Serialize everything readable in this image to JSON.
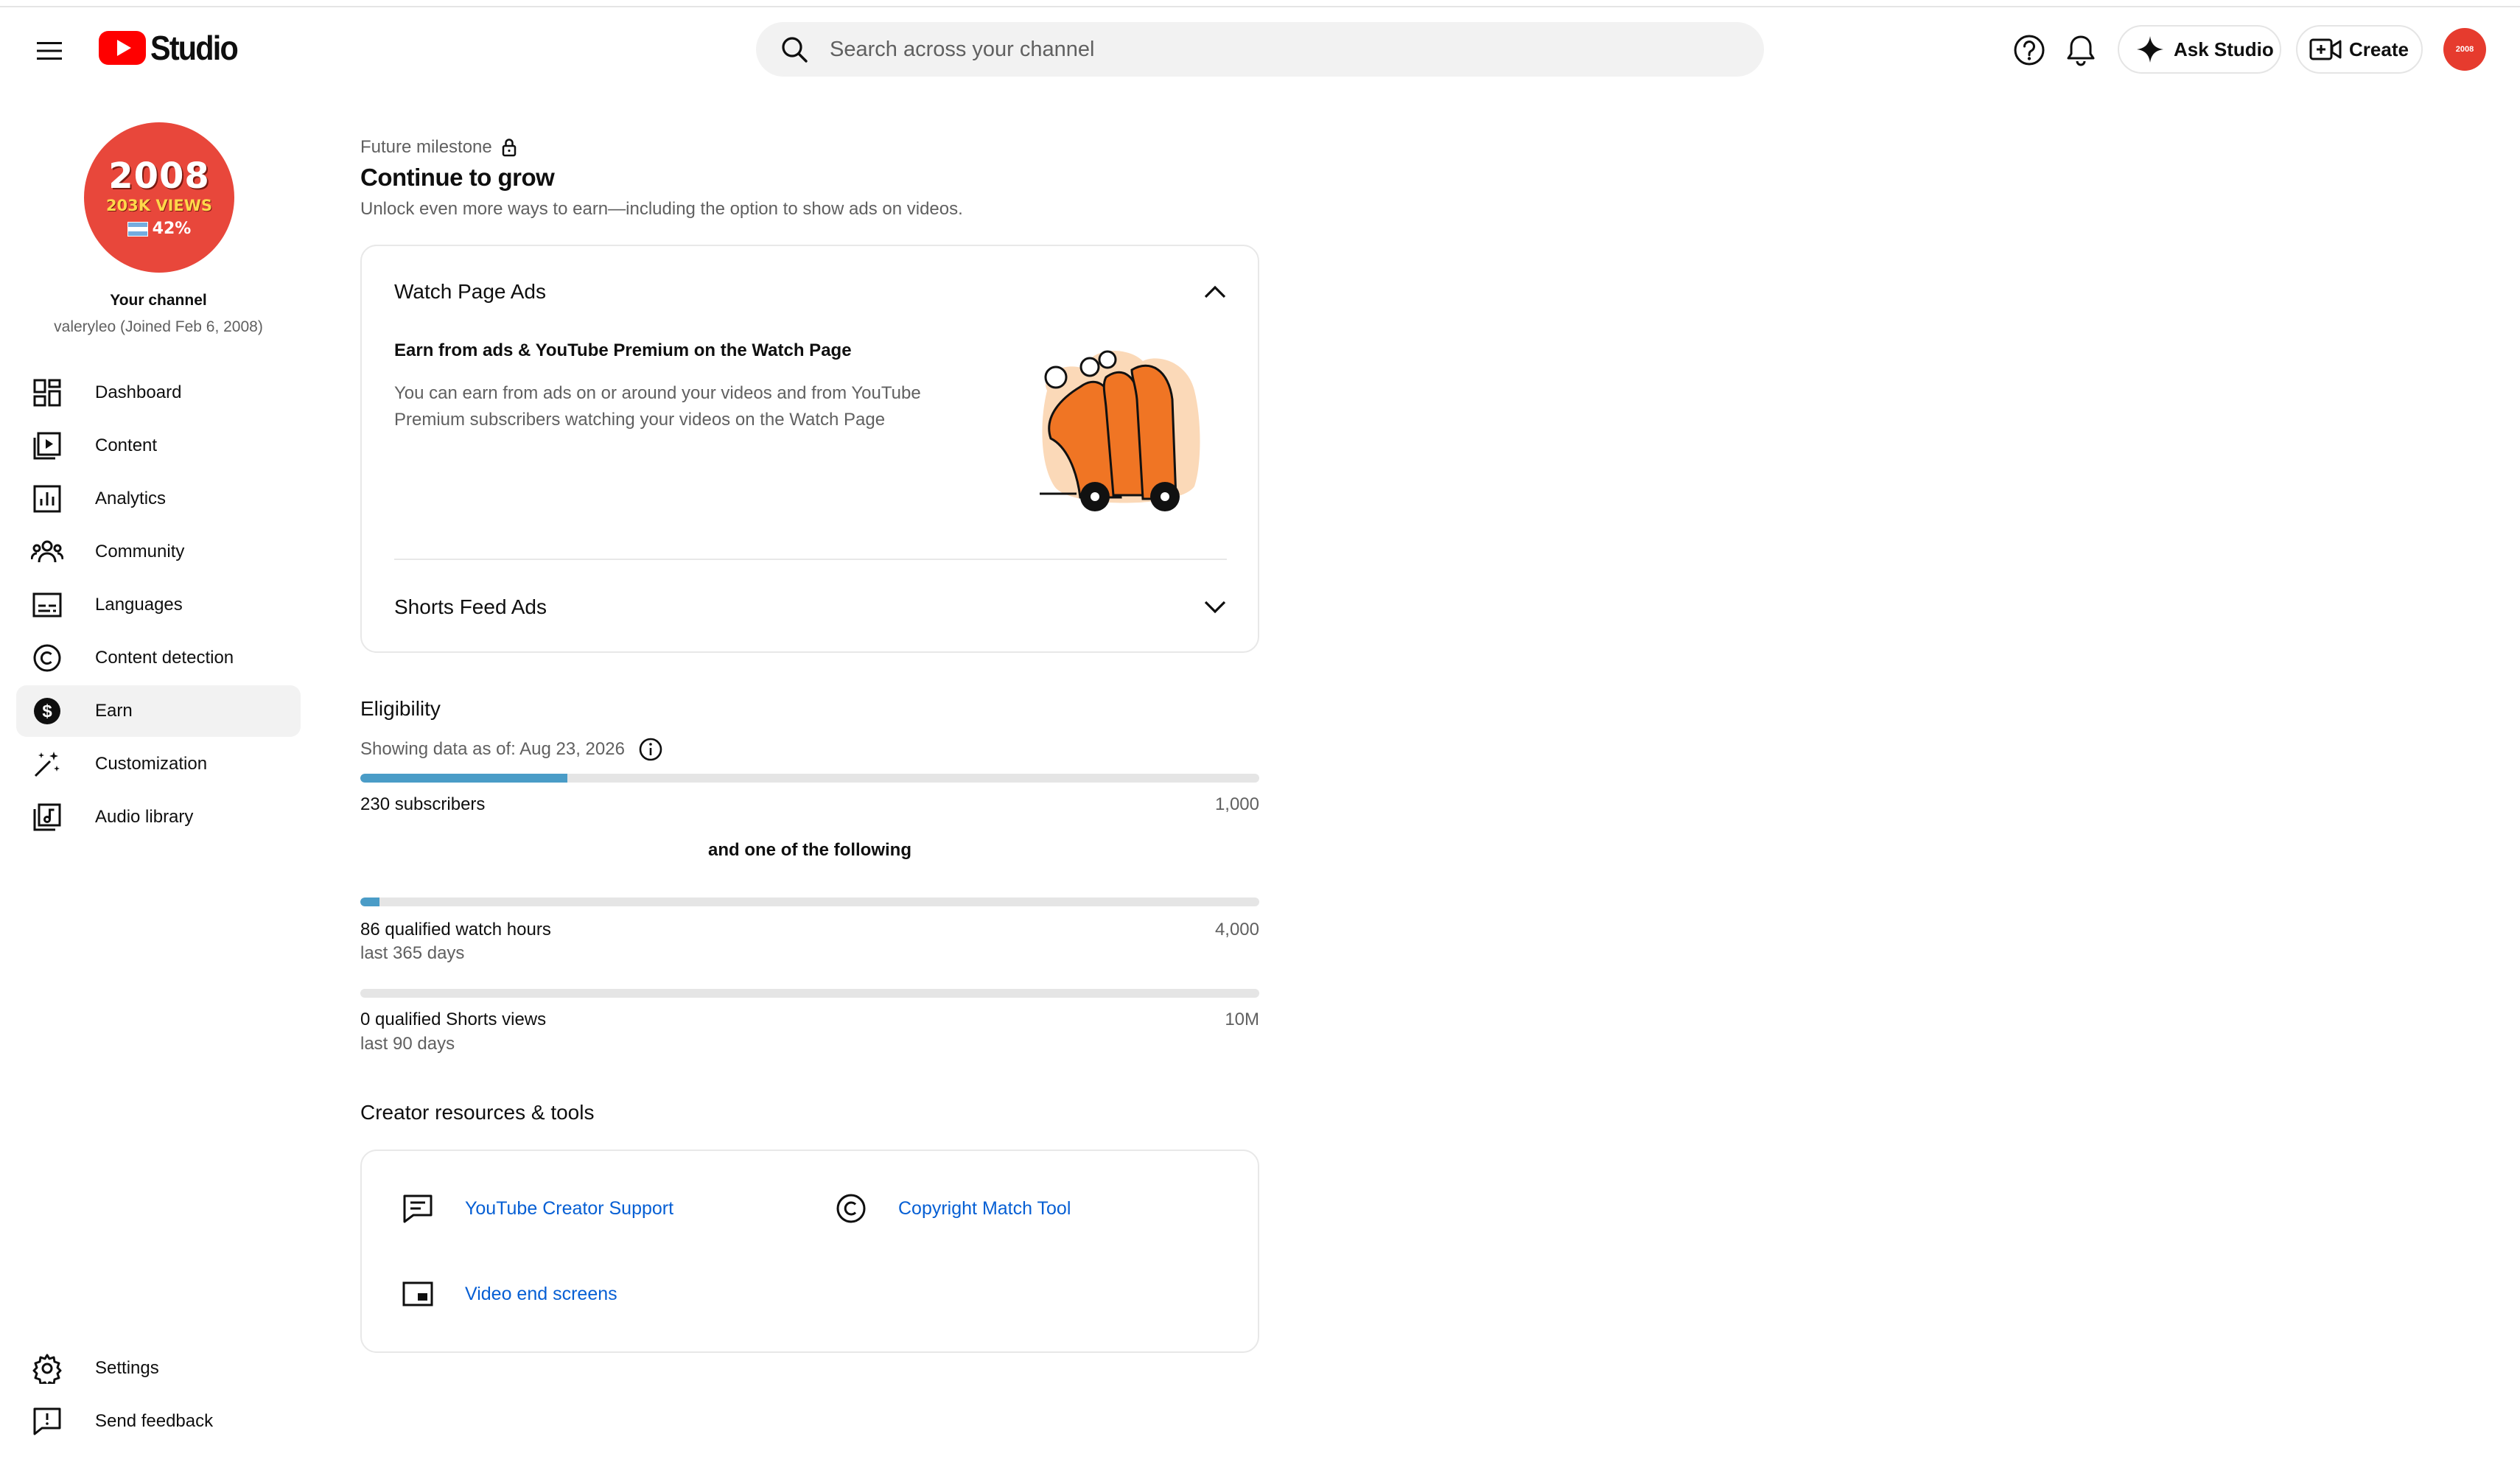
{
  "header": {
    "logo_text": "Studio",
    "search_placeholder": "Search across your channel",
    "ask_studio_label": "Ask Studio",
    "create_label": "Create",
    "avatar_small_text": "2008"
  },
  "sidebar": {
    "avatar": {
      "year": "2008",
      "views": "203K VIEWS",
      "pct": "42%"
    },
    "your_channel": "Your channel",
    "channel_sub": "valeryleo (Joined Feb 6, 2008)",
    "items": [
      {
        "label": "Dashboard",
        "icon": "dashboard-icon"
      },
      {
        "label": "Content",
        "icon": "content-icon"
      },
      {
        "label": "Analytics",
        "icon": "analytics-icon"
      },
      {
        "label": "Community",
        "icon": "community-icon"
      },
      {
        "label": "Languages",
        "icon": "subtitles-icon"
      },
      {
        "label": "Content detection",
        "icon": "copyright-icon"
      },
      {
        "label": "Earn",
        "icon": "dollar-icon",
        "active": true
      },
      {
        "label": "Customization",
        "icon": "magic-wand-icon"
      },
      {
        "label": "Audio library",
        "icon": "audio-library-icon"
      }
    ],
    "settings_label": "Settings",
    "feedback_label": "Send feedback"
  },
  "main": {
    "milestone_label": "Future milestone",
    "title": "Continue to grow",
    "subtitle": "Unlock even more ways to earn—including the option to show ads on videos.",
    "watch_ads": {
      "title": "Watch Page Ads",
      "heading": "Earn from ads & YouTube Premium on the Watch Page",
      "description": "You can earn from ads on or around your videos and from YouTube Premium subscribers watching your videos on the Watch Page"
    },
    "shorts_ads": {
      "title": "Shorts Feed Ads"
    },
    "eligibility": {
      "title": "Eligibility",
      "date": "Showing data as of: Aug 23, 2026",
      "and_one": "and one of the following",
      "subscribers": {
        "label": "230 subscribers",
        "max": "1,000",
        "progress": 0.23
      },
      "watch_hours": {
        "label": "86 qualified watch hours",
        "max": "4,000",
        "sub": "last 365 days",
        "progress": 0.0215
      },
      "shorts_views": {
        "label": "0 qualified Shorts views",
        "max": "10M",
        "sub": "last 90 days",
        "progress": 0
      }
    },
    "resources": {
      "title": "Creator resources & tools",
      "creator_support": "YouTube Creator Support",
      "copyright_tool": "Copyright Match Tool",
      "end_screens": "Video end screens"
    }
  },
  "colors": {
    "accent": "#065fd4",
    "progress": "#4a9cc7",
    "brand_red": "#ff0000"
  }
}
